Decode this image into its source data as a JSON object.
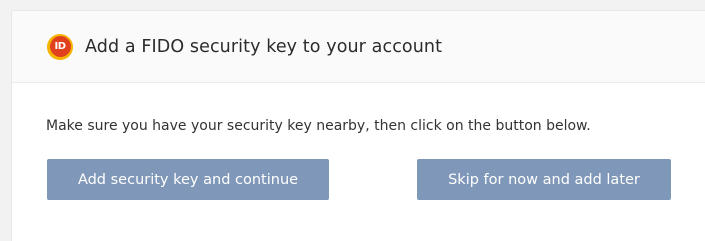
{
  "header": {
    "logo_text": "ID",
    "title": "Add a FIDO security key to your account"
  },
  "body": {
    "instructions": "Make sure you have your security key nearby, then click on the button below."
  },
  "buttons": {
    "add_label": "Add security key and continue",
    "skip_label": "Skip for now and add later"
  },
  "colors": {
    "button_bg": "#7f97b8",
    "logo_outer": "#f5b400",
    "logo_inner": "#e0401e"
  }
}
